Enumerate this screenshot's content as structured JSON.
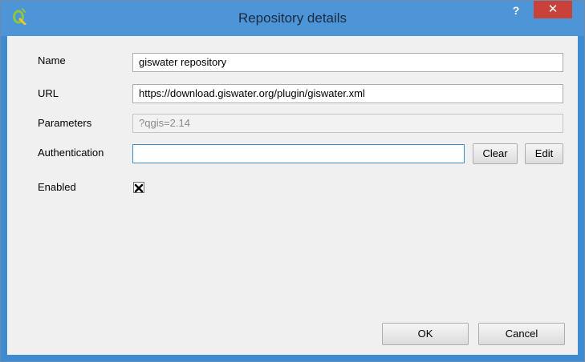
{
  "window": {
    "title": "Repository details",
    "help_label": "?",
    "close_label": "✕",
    "accent": "#4d95d6",
    "close_color": "#c8423a",
    "app_icon": "qgis-icon"
  },
  "form": {
    "name_label": "Name",
    "name_value": "giswater repository",
    "url_label": "URL",
    "url_value": "https://download.giswater.org/plugin/giswater.xml",
    "parameters_label": "Parameters",
    "parameters_value": "?qgis=2.14",
    "authentication_label": "Authentication",
    "authentication_value": "",
    "clear_label": "Clear",
    "edit_label": "Edit",
    "enabled_label": "Enabled",
    "enabled_checked": true
  },
  "footer": {
    "ok_label": "OK",
    "cancel_label": "Cancel"
  }
}
